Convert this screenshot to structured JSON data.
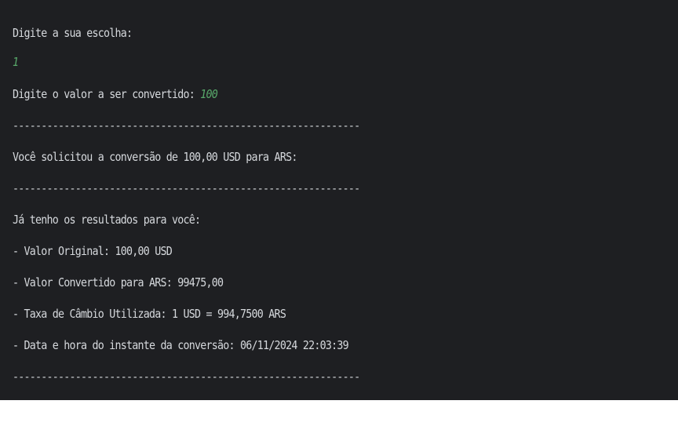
{
  "console": {
    "prompt_choice": "Digite a sua escolha:",
    "choice_input": "1",
    "prompt_value": "Digite o valor a ser convertido: ",
    "value_input": "100",
    "separator": "-------------------------------------------------------------",
    "request_line": "Você solicitou a conversão de 100,00 USD para ARS:",
    "results_header": "Já tenho os resultados para você:",
    "original_value": "- Valor Original: 100,00 USD",
    "converted_value": "- Valor Convertido para ARS: 99475,00",
    "exchange_rate": "- Taxa de Câmbio Utilizada: 1 USD = 994,7500 ARS",
    "timestamp": "- Data e hora do instante da conversão: 06/11/2024 22:03:39"
  },
  "colors": {
    "background": "#1e1f22",
    "text": "#d6d9dd",
    "user_input": "#58a86a"
  }
}
